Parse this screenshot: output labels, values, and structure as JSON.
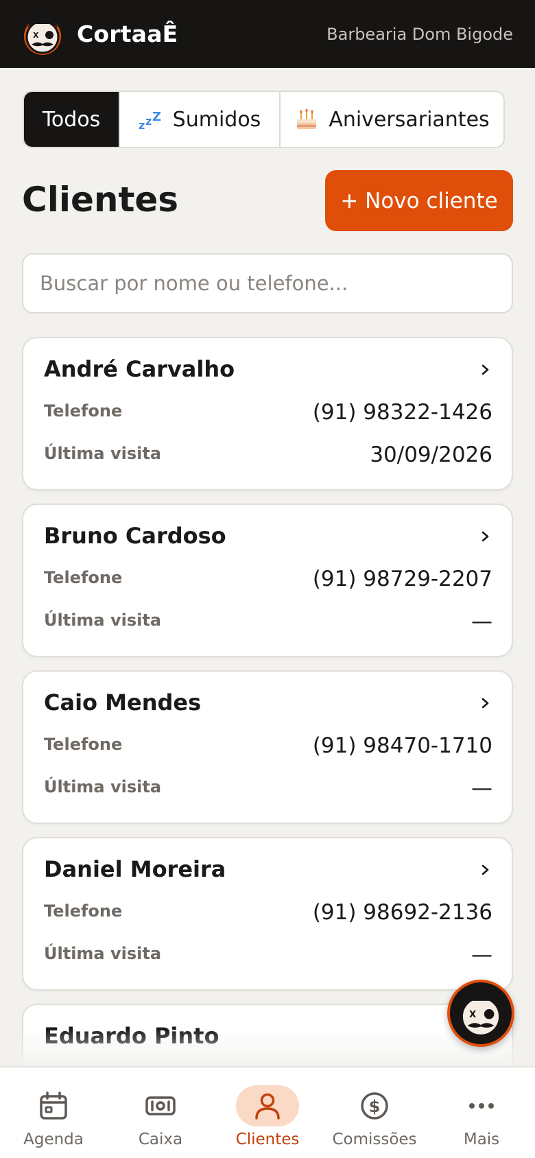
{
  "header": {
    "brand": "CortaaÊ",
    "shop_name": "Barbearia Dom Bigode"
  },
  "filters": [
    {
      "label": "Todos",
      "active": true
    },
    {
      "label": "Sumidos",
      "icon": "zzz-icon"
    },
    {
      "label": "Aniversariantes",
      "icon": "birthday-cake-icon"
    }
  ],
  "page": {
    "title": "Clientes",
    "new_client_label": "+ Novo cliente"
  },
  "search": {
    "placeholder": "Buscar por nome ou telefone...",
    "value": ""
  },
  "labels": {
    "phone": "Telefone",
    "last_visit": "Última visita"
  },
  "clients": [
    {
      "name": "André Carvalho",
      "phone": "(91) 98322-1426",
      "last_visit": "30/09/2026"
    },
    {
      "name": "Bruno Cardoso",
      "phone": "(91) 98729-2207",
      "last_visit": "—"
    },
    {
      "name": "Caio Mendes",
      "phone": "(91) 98470-1710",
      "last_visit": "—"
    },
    {
      "name": "Daniel Moreira",
      "phone": "(91) 98692-2136",
      "last_visit": "—"
    },
    {
      "name": "Eduardo Pinto"
    }
  ],
  "nav": [
    {
      "label": "Agenda",
      "icon": "calendar-icon"
    },
    {
      "label": "Caixa",
      "icon": "cash-icon"
    },
    {
      "label": "Clientes",
      "icon": "user-icon",
      "active": true
    },
    {
      "label": "Comissões",
      "icon": "dollar-circle-icon"
    },
    {
      "label": "Mais",
      "icon": "more-dots-icon"
    }
  ],
  "colors": {
    "accent": "#e04f0a",
    "dark": "#161514",
    "background": "#f2f1ee",
    "nav_active": "#c2410c"
  }
}
